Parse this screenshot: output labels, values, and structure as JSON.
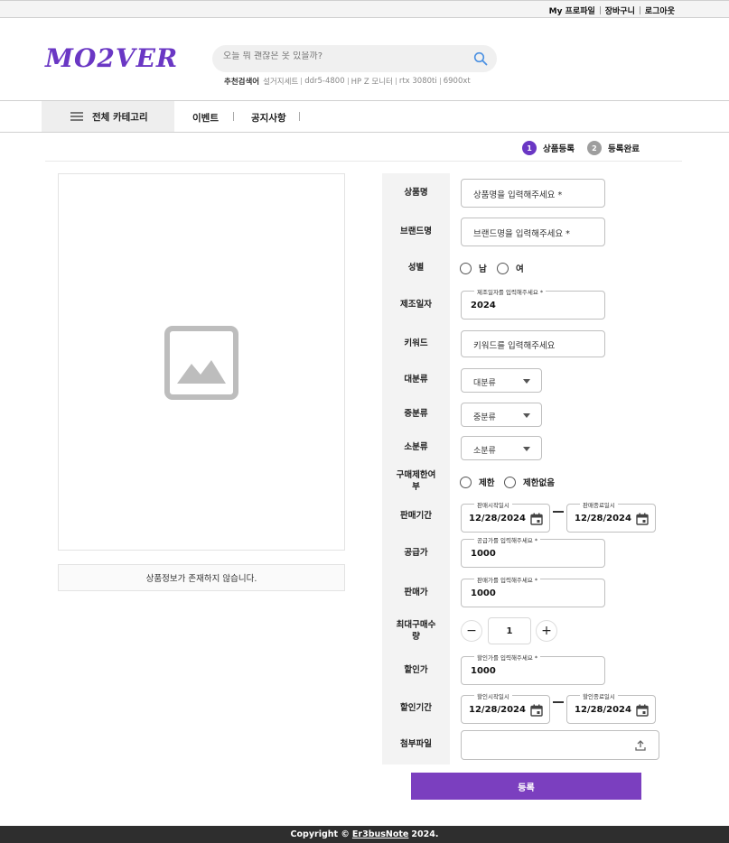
{
  "topbar": {
    "links": [
      "My 프로파일",
      "장바구니",
      "로그아웃"
    ]
  },
  "header": {
    "logo": "MO2VER",
    "search_placeholder": "오늘 뭐 괜찮은 옷 있을까?",
    "recommend_label": "추천검색어",
    "recommend": [
      "설거지세트",
      "ddr5-4800",
      "HP Z 모니터",
      "rtx 3080ti",
      "6900xt"
    ]
  },
  "nav": {
    "category": "전체 카테고리",
    "items": [
      "이벤트",
      "공지사항"
    ]
  },
  "steps": [
    {
      "num": "1",
      "label": "상품등록"
    },
    {
      "num": "2",
      "label": "등록완료"
    }
  ],
  "preview": {
    "no_info": "상품정보가 존재하지 않습니다."
  },
  "form": {
    "labels": {
      "name": "상품명",
      "brand": "브랜드명",
      "gender": "성별",
      "mfg_date": "제조일자",
      "keyword": "키워드",
      "major": "대분류",
      "middle": "중분류",
      "minor": "소분류",
      "limit_line1": "구매제한여",
      "limit_line2": "부",
      "sale_period": "판매기간",
      "supply_price": "공급가",
      "sale_price": "판매가",
      "max_qty_line1": "최대구매수",
      "max_qty_line2": "량",
      "discount_price": "할인가",
      "discount_period": "할인기간",
      "attachment": "첨부파일"
    },
    "name_placeholder": "상품명을 입력해주세요 *",
    "brand_placeholder": "브랜드명을 입력해주세요 *",
    "gender_options": [
      "남",
      "여"
    ],
    "mfg_legend": "제조일자를 입력해주세요 *",
    "mfg_value": "2024",
    "keyword_placeholder": "키워드를 입력해주세요",
    "major_value": "대분류",
    "middle_value": "중분류",
    "minor_value": "소분류",
    "limit_options": [
      "제한",
      "제한없음"
    ],
    "sale_start_legend": "판매시작일시",
    "sale_start_value": "12/28/2024",
    "sale_end_legend": "판매종료일시",
    "sale_end_value": "12/28/2024",
    "supply_legend": "공급가를 입력해주세요 *",
    "supply_value": "1000",
    "sale_legend": "판매가를 입력해주세요 *",
    "sale_value": "1000",
    "qty_value": "1",
    "minus": "−",
    "plus": "+",
    "discount_legend": "할인가를 입력해주세요 *",
    "discount_value": "1000",
    "disc_start_legend": "할인시작일시",
    "disc_start_value": "12/28/2024",
    "disc_end_legend": "할인종료일시",
    "disc_end_value": "12/28/2024",
    "submit": "등록"
  },
  "footer": {
    "prefix": "Copyright ©",
    "link": "Er3busNote",
    "suffix": "2024."
  },
  "colors": {
    "accent": "#7b3fbf",
    "logo": "#6a37c4",
    "search_icon": "#4a90e2"
  }
}
